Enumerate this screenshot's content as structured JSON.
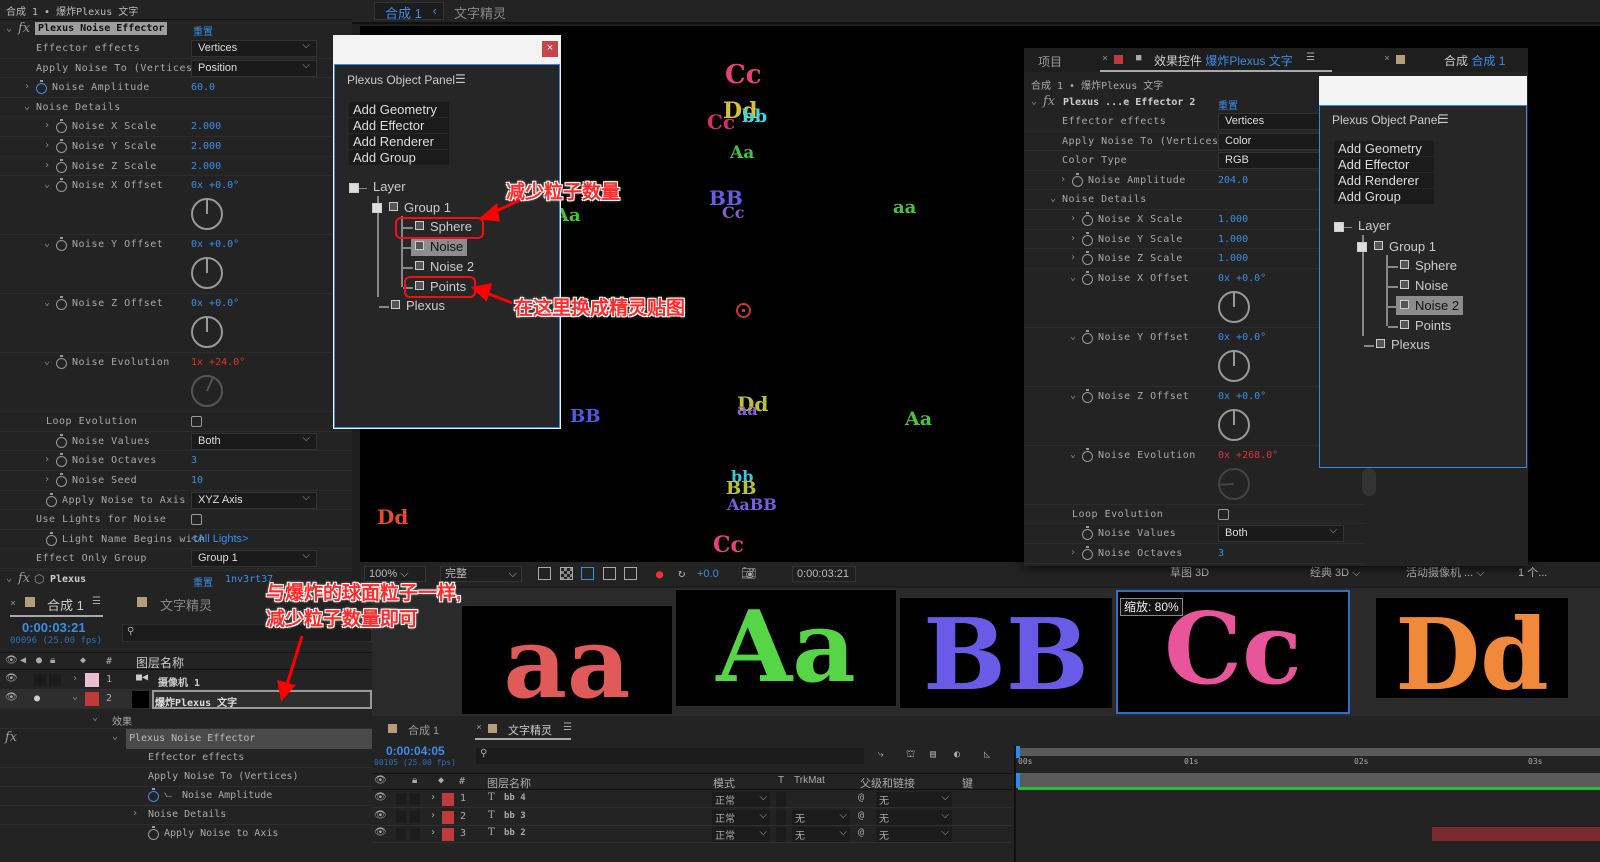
{
  "left_effect_panel": {
    "breadcrumb": "合成 1 • 爆炸Plexus 文字",
    "effect_name": "Plexus Noise Effector",
    "reset": "重置",
    "rows": [
      {
        "label": "Effector effects",
        "type": "dropdown",
        "value": "Vertices",
        "indent": 1
      },
      {
        "label": "Apply Noise To (Vertices)",
        "type": "dropdown",
        "value": "Position",
        "indent": 1
      },
      {
        "label": "Noise Amplitude",
        "type": "number",
        "value": "60.0",
        "indent": 1,
        "twirl": ">",
        "stopwatch": "blue"
      },
      {
        "label": "Noise Details",
        "type": "none",
        "indent": 1,
        "twirl": "v"
      },
      {
        "label": "Noise X Scale",
        "type": "number",
        "value": "2.000",
        "indent": 3,
        "twirl": ">",
        "stopwatch": "1"
      },
      {
        "label": "Noise Y Scale",
        "type": "number",
        "value": "2.000",
        "indent": 3,
        "twirl": ">",
        "stopwatch": "1"
      },
      {
        "label": "Noise Z Scale",
        "type": "number",
        "value": "2.000",
        "indent": 3,
        "twirl": ">",
        "stopwatch": "1"
      },
      {
        "label": "Noise X Offset",
        "type": "angle",
        "value": "0x +0.0°",
        "indent": 3,
        "twirl": "v",
        "stopwatch": "1",
        "dial": "1"
      },
      {
        "label": "Noise Y Offset",
        "type": "angle",
        "value": "0x +0.0°",
        "indent": 3,
        "twirl": "v",
        "stopwatch": "1",
        "dial": "1"
      },
      {
        "label": "Noise Z Offset",
        "type": "angle",
        "value": "0x +0.0°",
        "indent": 3,
        "twirl": "v",
        "stopwatch": "1",
        "dial": "1"
      },
      {
        "label": "Noise Evolution",
        "type": "angle",
        "value": "1x +24.0°",
        "red": true,
        "indent": 3,
        "twirl": "v",
        "stopwatch": "1",
        "dial": "dim"
      },
      {
        "label": "Loop Evolution",
        "type": "checkbox",
        "indent": 2
      },
      {
        "label": "Noise Values",
        "type": "dropdown",
        "value": "Both",
        "indent": 3,
        "stopwatch": "1"
      },
      {
        "label": "Noise Octaves",
        "type": "number",
        "value": "3",
        "indent": 3,
        "twirl": ">",
        "stopwatch": "1"
      },
      {
        "label": "Noise Seed",
        "type": "number",
        "value": "10",
        "indent": 3,
        "twirl": ">",
        "stopwatch": "1"
      },
      {
        "label": "Apply Noise to Axis",
        "type": "dropdown",
        "value": "XYZ Axis",
        "indent": 2,
        "stopwatch": "1"
      },
      {
        "label": "Use Lights for Noise",
        "type": "checkbox",
        "indent": 1
      },
      {
        "label": "Light Name Begins with",
        "type": "link",
        "value": "<All Lights>",
        "indent": 2,
        "stopwatch": "1"
      },
      {
        "label": "Effect Only Group",
        "type": "dropdown",
        "value": "Group 1",
        "indent": 1
      }
    ],
    "plexus_effect": {
      "name": "Plexus",
      "reset": "重置",
      "extra": "1nv3rt37"
    }
  },
  "viewer": {
    "tabs": [
      {
        "label": "合成 1"
      },
      {
        "label": "文字精灵"
      }
    ],
    "letters": [
      {
        "text": "Cc",
        "color": "#e8407a"
      },
      {
        "text": "Cc",
        "color": "#d9305a"
      },
      {
        "text": "Dd",
        "color": "#d6c23a"
      },
      {
        "text": "bb",
        "color": "#3fd6e0"
      },
      {
        "text": "Aa",
        "color": "#46c43c"
      },
      {
        "text": "Aa",
        "color": "#46c43c"
      },
      {
        "text": "BB",
        "color": "#6a5ce0"
      },
      {
        "text": "Cc",
        "color": "#8a5cd0"
      },
      {
        "text": "aa",
        "color": "#46c43c"
      },
      {
        "text": "BB",
        "color": "#4a5ce8"
      },
      {
        "text": "Dd",
        "color": "#b8c23a"
      },
      {
        "text": "aa",
        "color": "#8a5ce0"
      },
      {
        "text": "Aa",
        "color": "#46c43c"
      },
      {
        "text": "bb",
        "color": "#3fc4e0"
      },
      {
        "text": "BB",
        "color": "#b8c23a"
      },
      {
        "text": "AaBB",
        "color": "#7a5ce0"
      },
      {
        "text": "Dd",
        "color": "#e84a2a"
      },
      {
        "text": "Cc",
        "color": "#e8407a"
      }
    ],
    "toolbar": {
      "zoom": "100%",
      "quality": "完整",
      "exposure": "+0.0",
      "timecode": "0:00:03:21",
      "renderer": "草图 3D",
      "view_mode": "经典 3D",
      "camera": "活动摄像机 ...",
      "views": "1 个..."
    }
  },
  "object_panel_1": {
    "title": "Plexus Object Panel",
    "close": "×",
    "buttons": [
      "Add Geometry",
      "Add Effector",
      "Add Renderer",
      "Add Group"
    ],
    "tree": {
      "layer": "Layer",
      "group": "Group 1",
      "items": [
        "Sphere",
        "Noise",
        "Noise 2",
        "Points"
      ],
      "plexus": "Plexus",
      "selected": "Noise"
    }
  },
  "right_window": {
    "tabs": [
      {
        "label": "项目"
      },
      {
        "label": "效果控件",
        "target": "爆炸Plexus 文字"
      },
      {
        "label": "合成",
        "target": "合成 1"
      }
    ],
    "breadcrumb": "合成 1 • 爆炸Plexus 文字",
    "effect_name": "Plexus ...e Effector 2",
    "reset": "重置",
    "rows": [
      {
        "label": "Effector effects",
        "type": "dropdown",
        "value": "Vertices",
        "indent": 1
      },
      {
        "label": "Apply Noise To (Vertices)",
        "type": "dropdown",
        "value": "Color",
        "indent": 1
      },
      {
        "label": "Color Type",
        "type": "dropdown",
        "value": "RGB",
        "indent": 1
      },
      {
        "label": "Noise Amplitude",
        "type": "number",
        "value": "204.0",
        "indent": 2,
        "twirl": ">",
        "stopwatch": "1"
      },
      {
        "label": "Noise Details",
        "type": "none",
        "indent": 1,
        "twirl": "v"
      },
      {
        "label": "Noise X Scale",
        "type": "number",
        "value": "1.000",
        "indent": 3,
        "twirl": ">",
        "stopwatch": "1"
      },
      {
        "label": "Noise Y Scale",
        "type": "number",
        "value": "1.000",
        "indent": 3,
        "twirl": ">",
        "stopwatch": "1"
      },
      {
        "label": "Noise Z Scale",
        "type": "number",
        "value": "1.000",
        "indent": 3,
        "twirl": ">",
        "stopwatch": "1"
      },
      {
        "label": "Noise X Offset",
        "type": "angle",
        "value": "0x +0.0°",
        "indent": 3,
        "twirl": "v",
        "stopwatch": "1",
        "dial": "1"
      },
      {
        "label": "Noise Y Offset",
        "type": "angle",
        "value": "0x +0.0°",
        "indent": 3,
        "twirl": "v",
        "stopwatch": "1",
        "dial": "1"
      },
      {
        "label": "Noise Z Offset",
        "type": "angle",
        "value": "0x +0.0°",
        "indent": 3,
        "twirl": "v",
        "stopwatch": "1",
        "dial": "1"
      },
      {
        "label": "Noise Evolution",
        "type": "angle",
        "value": "0x +268.0°",
        "red": true,
        "indent": 3,
        "twirl": "v",
        "stopwatch": "1",
        "dial": "dim2"
      },
      {
        "label": "Loop Evolution",
        "type": "checkbox",
        "indent": 2
      },
      {
        "label": "Noise Values",
        "type": "dropdown",
        "value": "Both",
        "indent": 3,
        "stopwatch": "1"
      },
      {
        "label": "Noise Octaves",
        "type": "number",
        "value": "3",
        "indent": 3,
        "twirl": ">",
        "stopwatch": "1"
      }
    ]
  },
  "object_panel_2": {
    "title": "Plexus Object Panel",
    "buttons": [
      "Add Geometry",
      "Add Effector",
      "Add Renderer",
      "Add Group"
    ],
    "tree": {
      "layer": "Layer",
      "group": "Group 1",
      "items": [
        "Sphere",
        "Noise",
        "Noise 2",
        "Points"
      ],
      "plexus": "Plexus",
      "selected": "Noise 2"
    }
  },
  "timeline_1": {
    "tabs": [
      {
        "label": "合成 1"
      },
      {
        "label": "文字精灵"
      }
    ],
    "timecode": "0:00:03:21",
    "frames": "00096 (25.00 fps)",
    "col_name": "图层名称",
    "col_num": "#",
    "layers": [
      {
        "num": "1",
        "name": "摄像机 1",
        "color": "#e7bfcf"
      },
      {
        "num": "2",
        "name": "爆炸Plexus 文字",
        "color": "#c0393b"
      }
    ],
    "effects_group": "效果",
    "effect": "Plexus Noise Effector",
    "props": [
      "Effector effects",
      "Apply Noise To (Vertices)",
      "Noise Amplitude",
      "Noise Details",
      "Apply Noise to Axis"
    ]
  },
  "thumbnails": [
    {
      "text": "aa",
      "color": "#e05a5a"
    },
    {
      "text": "Aa",
      "color": "#56d646"
    },
    {
      "text": "BB",
      "color": "#6a5ae8"
    },
    {
      "text": "Cc",
      "color": "#e8559a",
      "zoom_label": "缩放: 80%"
    },
    {
      "text": "Dd",
      "color": "#f08a3a"
    }
  ],
  "timeline_2": {
    "tabs": [
      {
        "label": "合成 1"
      },
      {
        "label": "文字精灵"
      }
    ],
    "timecode": "0:00:04:05",
    "frames": "00105 (25.00 fps)",
    "columns": {
      "num": "#",
      "name": "图层名称",
      "mode": "模式",
      "t": "T",
      "trkmat": "TrkMat",
      "parent": "父级和链接",
      "key": "键"
    },
    "ruler": [
      "00s",
      "01s",
      "02s",
      "03s"
    ],
    "layers": [
      {
        "num": "1",
        "name": "bb 4",
        "mode": "正常",
        "trkmat": "",
        "parent": "无"
      },
      {
        "num": "2",
        "name": "bb 3",
        "mode": "正常",
        "trkmat": "无",
        "parent": "无"
      },
      {
        "num": "3",
        "name": "bb 2",
        "mode": "正常",
        "trkmat": "无",
        "parent": "无"
      }
    ]
  },
  "annotations": {
    "reduce_particles": "减少粒子数量",
    "replace_sprite": "在这里换成精灵贴图",
    "same_as_sphere_1": "与爆炸的球面粒子一样,",
    "same_as_sphere_2": "减少粒子数量即可"
  }
}
